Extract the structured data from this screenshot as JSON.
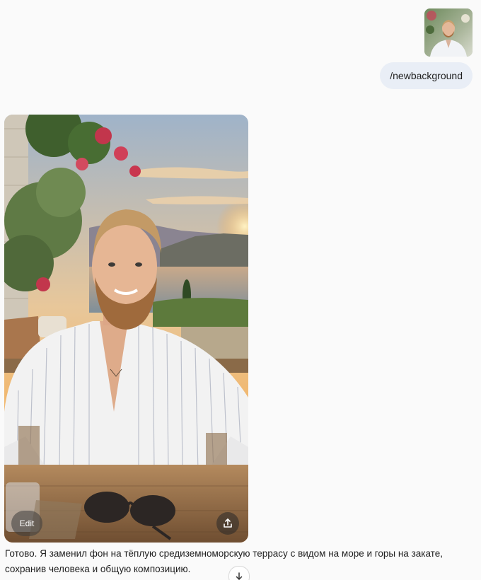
{
  "user_message": {
    "attachment": {
      "icon": "user-photo-thumbnail"
    },
    "text": "/newbackground"
  },
  "assistant_message": {
    "image": {
      "icon": "generated-photo",
      "edit_label": "Edit",
      "share_icon": "share-icon"
    },
    "text": "Готово. Я заменил фон на тёплую средиземноморскую террасу с видом на море и горы на закате, сохранив человека и общую композицию."
  },
  "scroll_down": {
    "icon": "arrow-down-icon"
  }
}
